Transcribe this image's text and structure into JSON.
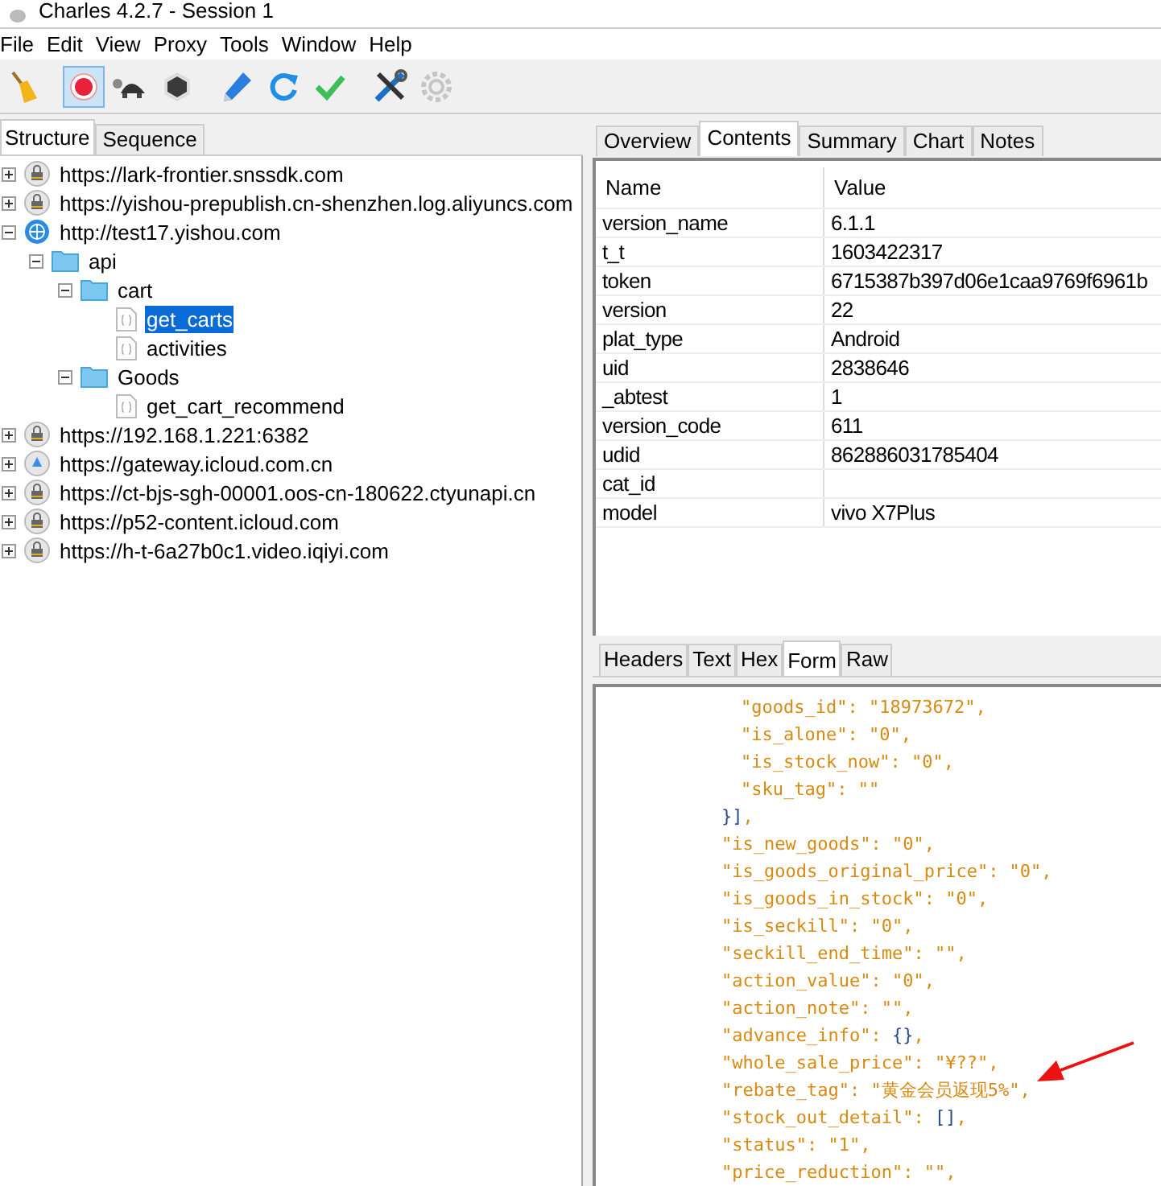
{
  "window": {
    "title": "Charles 4.2.7 - Session 1"
  },
  "menu": [
    "File",
    "Edit",
    "View",
    "Proxy",
    "Tools",
    "Window",
    "Help"
  ],
  "toolbar": [
    {
      "kind": "broom",
      "on": false
    },
    {
      "kind": "record",
      "on": true
    },
    {
      "kind": "turtle",
      "on": false
    },
    {
      "kind": "stop",
      "on": false
    },
    {
      "kind": "pen",
      "on": false
    },
    {
      "kind": "refresh",
      "on": false
    },
    {
      "kind": "check",
      "on": false
    },
    {
      "kind": "tools",
      "on": false
    },
    {
      "kind": "gear",
      "on": false
    }
  ],
  "left_tabs": [
    {
      "label": "Structure",
      "selected": true
    },
    {
      "label": "Sequence",
      "selected": false
    }
  ],
  "tree": [
    {
      "label": "https://lark-frontier.snssdk.com",
      "kind": "secure-host",
      "expanded": false,
      "selected": false
    },
    {
      "label": "https://yishou-prepublish.cn-shenzhen.log.aliyuncs.com",
      "kind": "secure-host",
      "expanded": false,
      "selected": false
    },
    {
      "label": "http://test17.yishou.com",
      "kind": "host",
      "expanded": true,
      "selected": false,
      "children": [
        {
          "label": "api",
          "kind": "folder",
          "expanded": true,
          "selected": false,
          "children": [
            {
              "label": "cart",
              "kind": "folder",
              "expanded": true,
              "selected": false,
              "children": [
                {
                  "label": "get_carts",
                  "kind": "file",
                  "selected": true
                },
                {
                  "label": "activities",
                  "kind": "file",
                  "selected": false
                }
              ]
            },
            {
              "label": "Goods",
              "kind": "folder",
              "expanded": true,
              "selected": false,
              "children": [
                {
                  "label": "get_cart_recommend",
                  "kind": "file",
                  "selected": false
                }
              ]
            }
          ]
        }
      ]
    },
    {
      "label": "https://192.168.1.221:6382",
      "kind": "secure-host",
      "expanded": false,
      "selected": false
    },
    {
      "label": "https://gateway.icloud.com.cn",
      "kind": "cloud-host",
      "expanded": false,
      "selected": false
    },
    {
      "label": "https://ct-bjs-sgh-00001.oos-cn-180622.ctyunapi.cn",
      "kind": "secure-host",
      "expanded": false,
      "selected": false
    },
    {
      "label": "https://p52-content.icloud.com",
      "kind": "secure-host",
      "expanded": false,
      "selected": false
    },
    {
      "label": "https://h-t-6a27b0c1.video.iqiyi.com",
      "kind": "secure-host",
      "expanded": false,
      "selected": false
    }
  ],
  "right_tabs": [
    {
      "label": "Overview",
      "selected": false
    },
    {
      "label": "Contents",
      "selected": true
    },
    {
      "label": "Summary",
      "selected": false
    },
    {
      "label": "Chart",
      "selected": false
    },
    {
      "label": "Notes",
      "selected": false
    }
  ],
  "table": {
    "columns": [
      "Name",
      "Value"
    ],
    "rows": [
      [
        "version_name",
        "6.1.1"
      ],
      [
        "t_t",
        "1603422317"
      ],
      [
        "token",
        "6715387b397d06e1caa9769f6961b"
      ],
      [
        "version",
        "22"
      ],
      [
        "plat_type",
        "Android"
      ],
      [
        "uid",
        "2838646"
      ],
      [
        "_abtest",
        "1"
      ],
      [
        "version_code",
        "611"
      ],
      [
        "udid",
        "862886031785404"
      ],
      [
        "cat_id",
        ""
      ],
      [
        "model",
        "vivo X7Plus"
      ]
    ]
  },
  "body_tabs": [
    {
      "label": "Headers",
      "selected": false
    },
    {
      "label": "Text",
      "selected": false
    },
    {
      "label": "Hex",
      "selected": false
    },
    {
      "label": "Form",
      "selected": true
    },
    {
      "label": "Raw",
      "selected": false
    }
  ],
  "code": {
    "inner_lines": [
      "\"goods_id\": \"18973672\",",
      "\"is_alone\": \"0\",",
      "\"is_stock_now\": \"0\",",
      "\"sku_tag\": \"\""
    ],
    "closing": "}],",
    "lines": [
      "\"is_new_goods\": \"0\",",
      "\"is_goods_original_price\": \"0\",",
      "\"is_goods_in_stock\": \"0\",",
      "\"is_seckill\": \"0\",",
      "\"seckill_end_time\": \"\",",
      "\"action_value\": \"0\",",
      "\"action_note\": \"\",",
      "\"advance_info\": {},",
      "\"whole_sale_price\": \"¥??\",",
      "\"rebate_tag\": \"黄金会员返现5%\",",
      "\"stock_out_detail\": [],",
      "\"status\": \"1\",",
      "\"price_reduction\": \"\","
    ]
  }
}
